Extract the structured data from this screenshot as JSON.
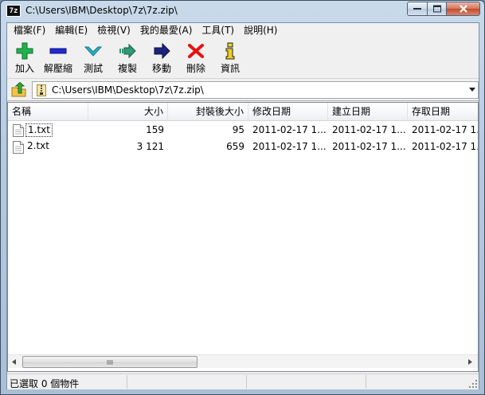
{
  "window": {
    "title": "C:\\Users\\IBM\\Desktop\\7z\\7z.zip\\",
    "app_icon_label": "7z"
  },
  "menu": [
    {
      "label": "檔案(F)"
    },
    {
      "label": "編輯(E)"
    },
    {
      "label": "檢視(V)"
    },
    {
      "label": "我的最愛(A)"
    },
    {
      "label": "工具(T)"
    },
    {
      "label": "說明(H)"
    }
  ],
  "toolbar": {
    "add": {
      "label": "加入",
      "icon": "plus-icon",
      "color": "#22b14c"
    },
    "extract": {
      "label": "解壓縮",
      "icon": "minus-icon",
      "color": "#1f2ad4"
    },
    "test": {
      "label": "測試",
      "icon": "check-down-icon",
      "color": "#29b6c8"
    },
    "copy": {
      "label": "複製",
      "icon": "copy-arrow-icon",
      "color": "#2f9a74"
    },
    "move": {
      "label": "移動",
      "icon": "move-arrow-icon",
      "color": "#1a237e"
    },
    "delete": {
      "label": "刪除",
      "icon": "delete-x-icon",
      "color": "#e81010"
    },
    "info": {
      "label": "資訊",
      "icon": "info-icon",
      "color": "#f1d21d"
    }
  },
  "address": {
    "value": "C:\\Users\\IBM\\Desktop\\7z\\7z.zip\\"
  },
  "list": {
    "columns": {
      "name": "名稱",
      "size": "大小",
      "packed": "封裝後大小",
      "modified": "修改日期",
      "created": "建立日期",
      "accessed": "存取日期"
    },
    "rows": [
      {
        "name": "1.txt",
        "size": "159",
        "packed": "95",
        "modified": "2011-02-17 1...",
        "created": "2011-02-17 1...",
        "accessed": "2011-02-17 1..."
      },
      {
        "name": "2.txt",
        "size": "3 121",
        "packed": "659",
        "modified": "2011-02-17 1...",
        "created": "2011-02-17 1...",
        "accessed": "2011-02-17 1..."
      }
    ]
  },
  "status": {
    "selection": "已選取 0 個物件",
    "section2": "",
    "section3": "",
    "section4": ""
  }
}
